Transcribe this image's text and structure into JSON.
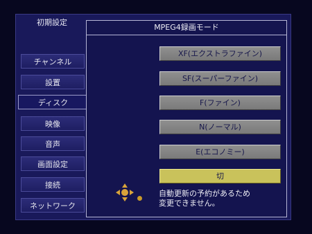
{
  "sidebar": {
    "title": "初期設定",
    "items": [
      {
        "label": "チャンネル"
      },
      {
        "label": "設置"
      },
      {
        "label": "ディスク"
      },
      {
        "label": "映像"
      },
      {
        "label": "音声"
      },
      {
        "label": "画面設定"
      },
      {
        "label": "接続"
      },
      {
        "label": "ネットワーク"
      }
    ],
    "active_index": 2
  },
  "panel": {
    "title": "MPEG4録画モード",
    "options": [
      {
        "label": "XF(エクストラファイン)"
      },
      {
        "label": "SF(スーパーファイン)"
      },
      {
        "label": "F(ファイン)"
      },
      {
        "label": "N(ノーマル)"
      },
      {
        "label": "E(エコノミー)"
      },
      {
        "label": "切"
      }
    ],
    "selected_index": 5,
    "message_line1": "自動更新の予約があるため",
    "message_line2": "変更できません。"
  },
  "icons": {
    "navigation": "dpad-icon",
    "indicator": "dot-icon"
  },
  "colors": {
    "background": "#19195a",
    "panel": "#14144f",
    "button": "#8f8f8f",
    "selected_button": "#c9c25b",
    "dpad": "#d9a43a"
  }
}
